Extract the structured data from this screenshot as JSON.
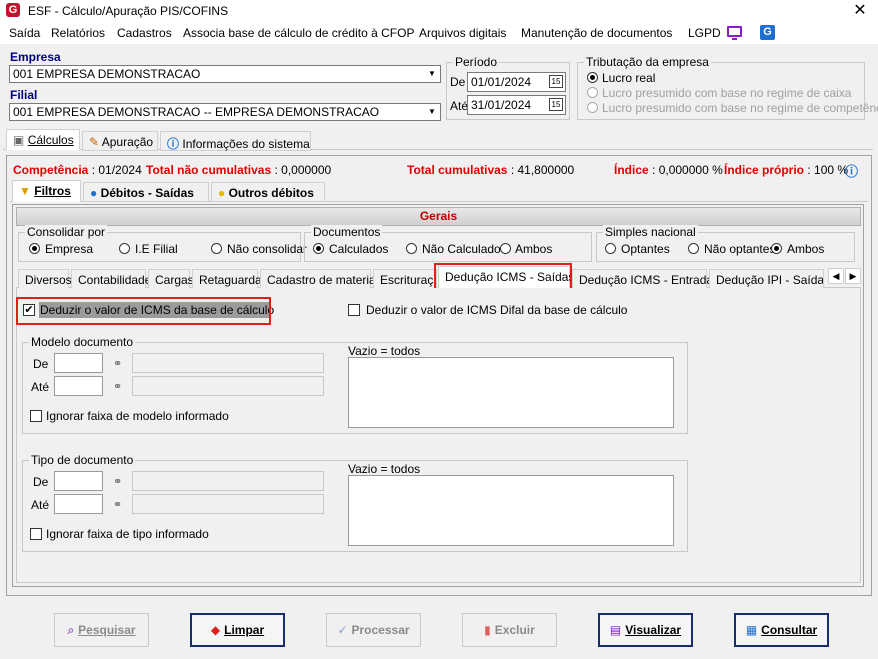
{
  "window": {
    "title": "ESF - Cálculo/Apuração PIS/COFINS",
    "app_icon": "G",
    "close": "✕"
  },
  "menu": [
    "Saída",
    "Relatórios",
    "Cadastros",
    "Associa base de cálculo de crédito à CFOP",
    "Arquivos digitais",
    "Manutenção de documentos",
    "LGPD"
  ],
  "menu_icons": {
    "monitor": "monitor-icon",
    "g": "G"
  },
  "empresa": {
    "label": "Empresa",
    "value": "001 EMPRESA DEMONSTRACAO"
  },
  "filial": {
    "label": "Filial",
    "value": "001 EMPRESA DEMONSTRACAO -- EMPRESA DEMONSTRACAO"
  },
  "periodo": {
    "title": "Período",
    "de_label": "De",
    "de_value": "01/01/2024",
    "ate_label": "Até",
    "ate_value": "31/01/2024",
    "cal_text": "15"
  },
  "tributacao": {
    "title": "Tributação da empresa",
    "options": [
      {
        "label": "Lucro real",
        "selected": true,
        "enabled": true
      },
      {
        "label": "Lucro presumido com base no regime de caixa",
        "selected": false,
        "enabled": false
      },
      {
        "label": "Lucro presumido com base no regime de competência",
        "selected": false,
        "enabled": false
      }
    ]
  },
  "main_tabs": [
    "Cálculos",
    "Apuração",
    "Informações do sistema"
  ],
  "summary": {
    "competencia_label": "Competência",
    "competencia_value": ": 01/2024",
    "total_nc_label": "Total não cumulativas",
    "total_nc_value": ": 0,000000",
    "total_c_label": "Total cumulativas",
    "total_c_value": ": 41,800000",
    "indice_label": "Índice",
    "indice_value": ": 0,000000 %",
    "indice_proprio_label": "Índice próprio",
    "indice_proprio_value": ": 100 %"
  },
  "sub_tabs": [
    "Filtros",
    "Débitos - Saídas",
    "Outros débitos"
  ],
  "gerais": {
    "title": "Gerais"
  },
  "consolidar": {
    "title": "Consolidar por",
    "options": [
      {
        "label": "Empresa",
        "selected": true
      },
      {
        "label": "I.E Filial",
        "selected": false
      },
      {
        "label": "Não consolidar",
        "selected": false
      }
    ]
  },
  "documentos": {
    "title": "Documentos",
    "options": [
      {
        "label": "Calculados",
        "selected": true
      },
      {
        "label": "Não Calculados",
        "selected": false
      },
      {
        "label": "Ambos",
        "selected": false
      }
    ]
  },
  "simples": {
    "title": "Simples nacional",
    "options": [
      {
        "label": "Optantes",
        "selected": false
      },
      {
        "label": "Não optantes",
        "selected": false
      },
      {
        "label": "Ambos",
        "selected": true
      }
    ]
  },
  "filter_tabs": [
    "Diversos",
    "Contabilidade",
    "Cargas",
    "Retaguarda",
    "Cadastro de materiais",
    "Escrituração",
    "Dedução ICMS - Saídas",
    "Dedução ICMS - Entradas",
    "Dedução IPI - Saídas"
  ],
  "tab_arrows": {
    "left": "◀",
    "right": "▶"
  },
  "deduzir_icms": {
    "label": "Deduzir o valor de ICMS da base de cálculo",
    "checked": true
  },
  "deduzir_difal": {
    "label": "Deduzir o valor de ICMS Difal da base de cálculo",
    "checked": false
  },
  "modelo": {
    "title": "Modelo documento",
    "de_label": "De",
    "ate_label": "Até",
    "ignorar_label": "Ignorar faixa de modelo informado",
    "vazio_label": "Vazio = todos"
  },
  "tipo": {
    "title": "Tipo de documento",
    "de_label": "De",
    "ate_label": "Até",
    "ignorar_label": "Ignorar faixa de tipo informado",
    "vazio_label": "Vazio = todos"
  },
  "buttons": {
    "pesquisar": {
      "label": "Pesquisar",
      "icon": "🔍",
      "enabled": false
    },
    "limpar": {
      "label": "Limpar",
      "icon": "◆",
      "enabled": true
    },
    "processar": {
      "label": "Processar",
      "icon": "✓",
      "enabled": false
    },
    "excluir": {
      "label": "Excluir",
      "icon": "🗑",
      "enabled": false
    },
    "visualizar": {
      "label": "Visualizar",
      "icon": "🖶",
      "enabled": true
    },
    "consultar": {
      "label": "Consultar",
      "icon": "▦",
      "enabled": true
    }
  },
  "colors": {
    "accent_blue": "#000080",
    "red": "#e00000",
    "highlight": "#e0201a"
  }
}
